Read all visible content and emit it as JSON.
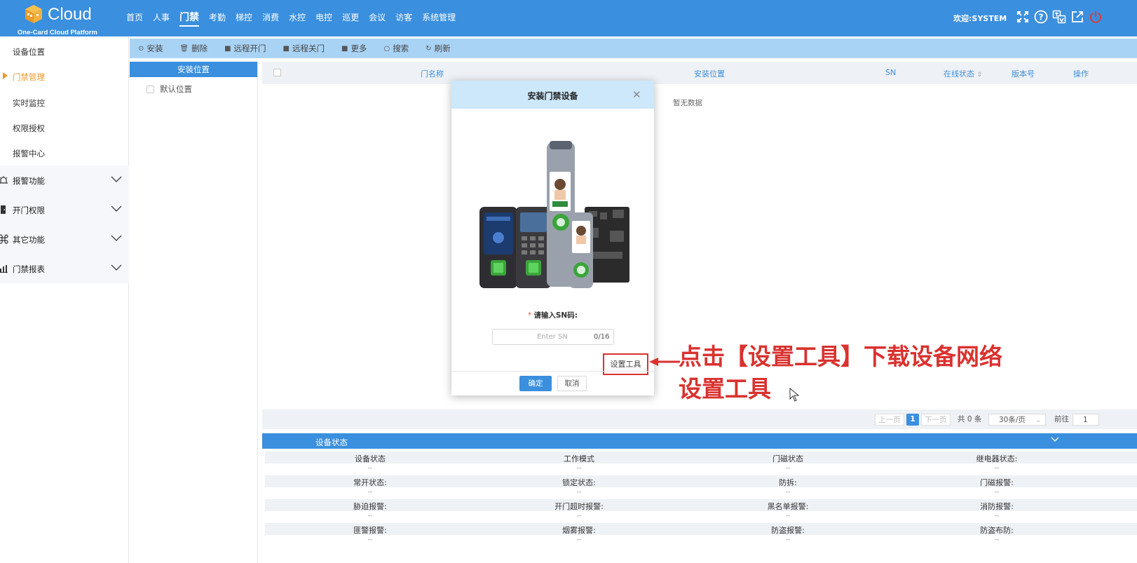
{
  "header": {
    "brand": "Cloud",
    "subtitle": "One-Card Cloud Platform",
    "nav": [
      "首页",
      "人事",
      "门禁",
      "考勤",
      "梯控",
      "消费",
      "水控",
      "电控",
      "巡更",
      "会议",
      "访客",
      "系统管理"
    ],
    "active_nav": "门禁",
    "welcome": "欢迎:SYSTEM",
    "icons": [
      "fullscreen-icon",
      "help-icon",
      "language-icon",
      "external-link-icon",
      "power-icon"
    ],
    "colors": {
      "primary": "#3a8fde",
      "accent": "#e89a2d",
      "annotation": "#d9322f"
    }
  },
  "sidebar": {
    "items": [
      {
        "label": "设备位置",
        "active": false
      },
      {
        "label": "门禁管理",
        "active": true
      },
      {
        "label": "实时监控",
        "active": false
      },
      {
        "label": "权限授权",
        "active": false
      },
      {
        "label": "报警中心",
        "active": false
      }
    ],
    "groups": [
      {
        "label": "报警功能",
        "icon": "alarm-icon"
      },
      {
        "label": "开门权限",
        "icon": "door-icon"
      },
      {
        "label": "其它功能",
        "icon": "command-icon"
      },
      {
        "label": "门禁报表",
        "icon": "report-icon"
      }
    ]
  },
  "toolbar": {
    "buttons": [
      {
        "label": "安装",
        "icon": "install-icon"
      },
      {
        "label": "删除",
        "icon": "trash-icon"
      },
      {
        "label": "远程开门",
        "icon": "remote-icon"
      },
      {
        "label": "远程关门",
        "icon": "remote-icon"
      },
      {
        "label": "更多",
        "icon": "more-icon"
      },
      {
        "label": "搜索",
        "icon": "search-icon"
      },
      {
        "label": "刷新",
        "icon": "refresh-icon"
      }
    ]
  },
  "location_panel": {
    "header": "安装位置",
    "items": [
      "默认位置"
    ]
  },
  "table": {
    "columns": [
      "门名称",
      "安装位置",
      "SN",
      "在线状态",
      "版本号",
      "操作"
    ],
    "empty_text": "暂无数据"
  },
  "pagination": {
    "prev": "上一页",
    "current": "1",
    "next": "下一页",
    "total": "共 0 条",
    "page_size": "30条/页",
    "goto_label": "前往",
    "goto_value": "1"
  },
  "device_status": {
    "title": "设备状态",
    "rows": [
      [
        "设备状态",
        "工作模式",
        "门磁状态",
        "继电器状态:"
      ],
      [
        "常开状态:",
        "锁定状态:",
        "防拆:",
        "门磁报警:"
      ],
      [
        "胁迫报警:",
        "开门超时报警:",
        "黑名单报警:",
        "消防报警:"
      ],
      [
        "匪警报警:",
        "烟雾报警:",
        "防盗报警:",
        "防盗布防:"
      ]
    ],
    "empty_value": "--"
  },
  "modal": {
    "title": "安装门禁设备",
    "sn_label": "请输入SN码:",
    "required_mark": "*",
    "sn_placeholder": "Enter SN",
    "sn_value": "",
    "sn_counter": "0/16",
    "setup_tool": "设置工具",
    "ok": "确定",
    "cancel": "取消"
  },
  "annotation": {
    "line1": "点击【设置工具】下载设备网络",
    "line2": "设置工具"
  }
}
